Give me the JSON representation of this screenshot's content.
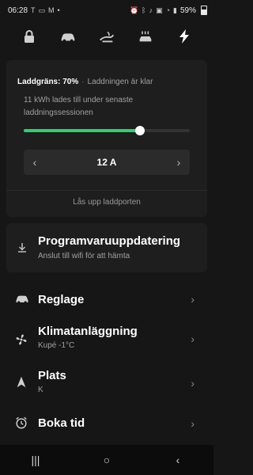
{
  "status_bar": {
    "time": "06:28",
    "left_icons": [
      "t-icon",
      "message-icon",
      "m-icon",
      "dot-icon"
    ],
    "right_icons": [
      "alarm-icon",
      "bluetooth-icon",
      "mute-icon",
      "volte-icon",
      "wifi-icon",
      "signal-icon"
    ],
    "battery": "59%"
  },
  "top_nav": [
    {
      "name": "lock",
      "icon": "lock-icon"
    },
    {
      "name": "car",
      "icon": "car-icon"
    },
    {
      "name": "fan",
      "icon": "fan-icon"
    },
    {
      "name": "climate",
      "icon": "heated-seat-icon"
    },
    {
      "name": "charging",
      "icon": "lightning-icon"
    }
  ],
  "charging": {
    "limit_label": "Laddgräns: 70%",
    "status": "Laddningen är klar",
    "info": "11 kWh lades till under senaste laddningssessionen",
    "slider_level": 0.7,
    "amps": "12 A",
    "dec_label": "‹",
    "inc_label": "›",
    "unlock_port": "Lås upp laddporten"
  },
  "software_update": {
    "title": "Programvaruuppdatering",
    "subtitle": "Anslut till wifi för att hämta"
  },
  "menu": [
    {
      "key": "controls",
      "title": "Reglage",
      "subtitle": "",
      "icon": "car-icon"
    },
    {
      "key": "climate",
      "title": "Klimatanläggning",
      "subtitle": "Kupé -1°C",
      "icon": "fan-icon"
    },
    {
      "key": "location",
      "title": "Plats",
      "subtitle": "K",
      "icon": "navigation-arrow-icon"
    },
    {
      "key": "schedule",
      "title": "Boka tid",
      "subtitle": "",
      "icon": "alarm-clock-icon"
    }
  ],
  "bottom_nav": {
    "recents": "|||",
    "home": "○",
    "back": "‹"
  }
}
